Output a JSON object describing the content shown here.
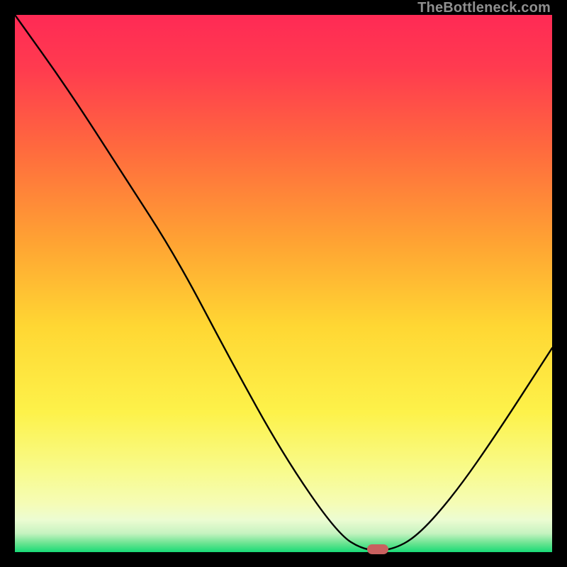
{
  "watermark": "TheBottleneck.com",
  "marker_color": "#c9605f",
  "chart_data": {
    "type": "line",
    "title": "",
    "xlabel": "",
    "ylabel": "",
    "xlim": [
      0,
      100
    ],
    "ylim": [
      0,
      100
    ],
    "series": [
      {
        "name": "curve",
        "points": [
          {
            "x": 0.0,
            "y": 100.0
          },
          {
            "x": 10.0,
            "y": 86.0
          },
          {
            "x": 20.0,
            "y": 70.5
          },
          {
            "x": 30.0,
            "y": 55.0
          },
          {
            "x": 40.0,
            "y": 36.0
          },
          {
            "x": 50.0,
            "y": 18.0
          },
          {
            "x": 60.0,
            "y": 3.5
          },
          {
            "x": 65.0,
            "y": 0.3
          },
          {
            "x": 70.0,
            "y": 0.3
          },
          {
            "x": 75.0,
            "y": 3.0
          },
          {
            "x": 82.0,
            "y": 11.0
          },
          {
            "x": 90.0,
            "y": 22.5
          },
          {
            "x": 100.0,
            "y": 38.0
          }
        ]
      }
    ],
    "optimum": {
      "x": 67.5,
      "y": 0.3
    },
    "gradient_stops": [
      {
        "offset": 0.0,
        "color": "#ff2a55"
      },
      {
        "offset": 0.1,
        "color": "#ff3b4f"
      },
      {
        "offset": 0.25,
        "color": "#ff6a3e"
      },
      {
        "offset": 0.42,
        "color": "#ffa233"
      },
      {
        "offset": 0.58,
        "color": "#ffd733"
      },
      {
        "offset": 0.74,
        "color": "#fdf24a"
      },
      {
        "offset": 0.85,
        "color": "#f8fb8d"
      },
      {
        "offset": 0.91,
        "color": "#f5fcb6"
      },
      {
        "offset": 0.94,
        "color": "#ecfcd2"
      },
      {
        "offset": 0.965,
        "color": "#c6f3c0"
      },
      {
        "offset": 0.985,
        "color": "#63e38e"
      },
      {
        "offset": 1.0,
        "color": "#18db77"
      }
    ]
  }
}
